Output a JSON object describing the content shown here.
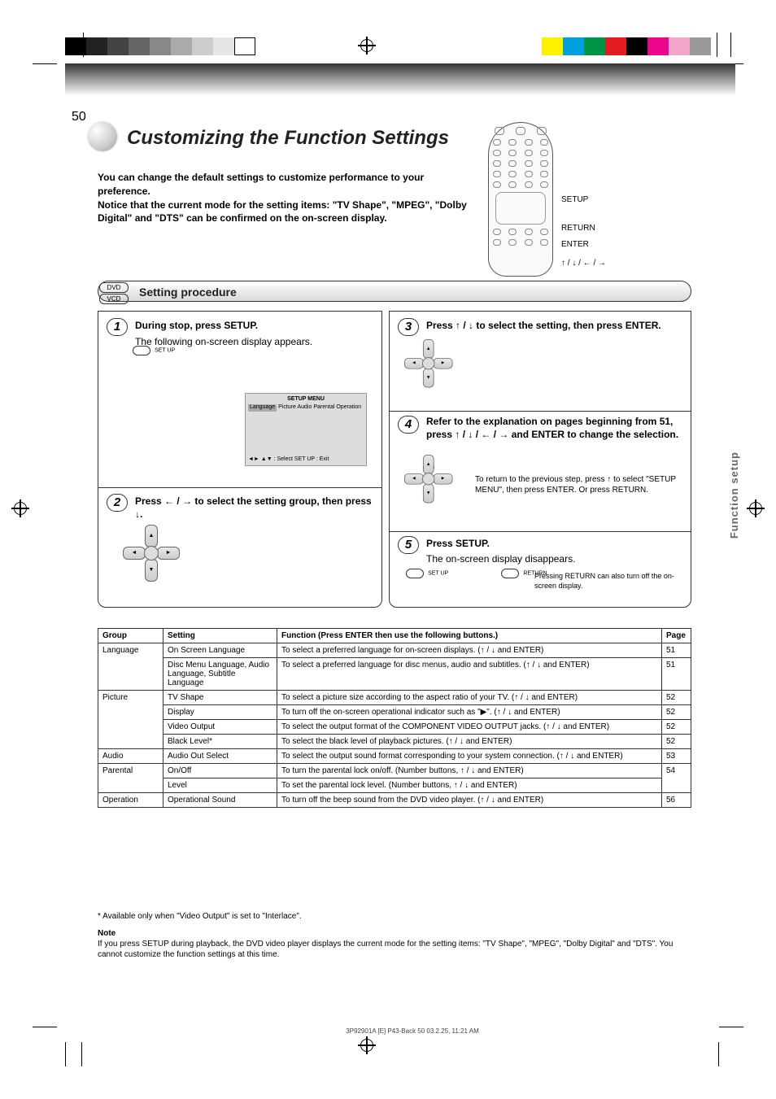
{
  "page_number": "50",
  "title": "Customizing the Function Settings",
  "intro_line1": "You can change the default settings to customize performance to your preference.",
  "intro_line2": "Notice that the current mode for the setting items: \"TV Shape\", \"MPEG\", \"Dolby Digital\" and \"DTS\" can be confirmed on the on-screen display.",
  "side_category": "Function setup",
  "remote_labels": {
    "setup": "SETUP",
    "return": "RETURN",
    "enter": "ENTER",
    "arrows": "↑ / ↓ / ← / →"
  },
  "bar_dvd": "DVD",
  "bar_vcd": "VCD",
  "section_bar_title": "Setting procedure",
  "step1_title": "During stop, press SETUP.",
  "step1_sub": "The following on-screen display appears.",
  "step1_screen_header": "SETUP MENU",
  "step1_screen_items": [
    "Language",
    "Picture",
    "Audio",
    "Parental",
    "Operation"
  ],
  "step1_screen_select_hint": "◄► ▲▼ : Select   SET UP : Exit",
  "step2_text": "Press ← / → to select the setting group, then press ↓.",
  "step3_text": "Press ↑ / ↓ to select the setting, then press ENTER.",
  "step4_text": "Refer to the explanation on pages beginning from 51, press ↑ / ↓ / ← / → and ENTER to",
  "step4_text2": "change the selection.",
  "step4_text3": "To return to the previous step, press ↑ to select \"SETUP MENU\", then press ENTER. Or press RETURN.",
  "step5_text": "Press SETUP.",
  "step5_sub": "The on-screen display disappears.",
  "step5_note": "Pressing RETURN can also turn off the on-screen display.",
  "btn_setup": "SET UP",
  "btn_return": "RETURN",
  "table": {
    "headers": [
      "Group",
      "Setting",
      "Function (Press ENTER then use the following buttons.)",
      "Page"
    ],
    "rows": [
      {
        "group": "Language",
        "setting": "On Screen Language",
        "func": "To select a preferred language for on-screen displays. (↑ / ↓ and ENTER)",
        "page": "51"
      },
      {
        "group": "",
        "setting": "Disc Menu Language, Audio Language, Subtitle Language",
        "func": "To select a preferred language for disc menus, audio and subtitles. (↑ / ↓ and ENTER)",
        "page": "51"
      },
      {
        "group": "Picture",
        "setting": "TV Shape",
        "func": "To select a picture size according to the aspect ratio of your TV. (↑ / ↓ and ENTER)",
        "page": "52"
      },
      {
        "group": "",
        "setting": "Display",
        "func": "To turn off the on-screen operational indicator such as \"▶\". (↑ / ↓ and ENTER)",
        "page": "52"
      },
      {
        "group": "",
        "setting": "Video Output",
        "func": "To select the output format of the COMPONENT VIDEO OUTPUT jacks. (↑ / ↓ and ENTER)",
        "page": "52"
      },
      {
        "group": "",
        "setting": "Black Level*",
        "func": "To select the black level of playback pictures. (↑ / ↓ and ENTER)",
        "page": "52"
      },
      {
        "group": "Audio",
        "setting": "Audio Out Select",
        "func": "To select the output sound format corresponding to your system connection. (↑ / ↓ and ENTER)",
        "page": "53"
      },
      {
        "group": "Parental",
        "setting": "On/Off",
        "func": "To turn the parental lock on/off. (Number buttons, ↑ / ↓ and ENTER)",
        "page": "54"
      },
      {
        "group": "",
        "setting": "Level",
        "func": "To set the parental lock level. (Number buttons, ↑ / ↓ and ENTER)",
        "page": "54"
      },
      {
        "group": "Operation",
        "setting": "Operational Sound",
        "func": "To turn off the beep sound from the DVD video player. (↑ / ↓ and ENTER)",
        "page": "56"
      }
    ]
  },
  "footnote1": "* Available only when \"Video Output\" is set to \"Interlace\".",
  "footnote2_label": "Note",
  "footnote2": "If you press SETUP during playback, the DVD video player displays the current mode for the setting items: \"TV Shape\", \"MPEG\", \"Dolby Digital\" and \"DTS\". You cannot customize the function settings at this time.",
  "footer_meta": "3P92901A [E] P43-Back    50    03.2.25, 11:21 AM"
}
